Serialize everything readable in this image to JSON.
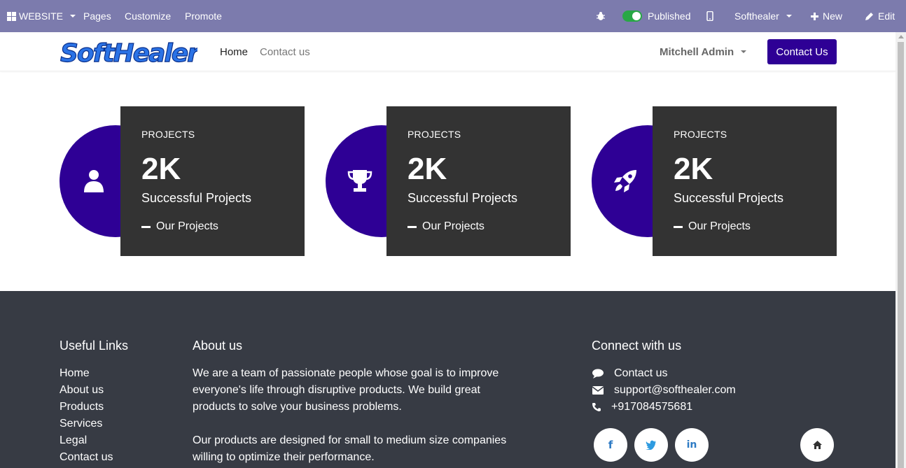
{
  "adminbar": {
    "website_label": "WEBSITE",
    "pages_label": "Pages",
    "customize_label": "Customize",
    "promote_label": "Promote",
    "published_label": "Published",
    "company_label": "Softhealer",
    "new_label": "New",
    "edit_label": "Edit"
  },
  "header": {
    "logo_text": "SoftHealer",
    "nav": [
      {
        "label": "Home"
      },
      {
        "label": "Contact us"
      }
    ],
    "user_label": "Mitchell Admin",
    "cta_label": "Contact Us"
  },
  "stats": [
    {
      "label": "PROJECTS",
      "number": "2K",
      "description": "Successful Projects",
      "link": "Our Projects",
      "icon": "user-icon"
    },
    {
      "label": "PROJECTS",
      "number": "2K",
      "description": "Successful Projects",
      "link": "Our Projects",
      "icon": "trophy-icon"
    },
    {
      "label": "PROJECTS",
      "number": "2K",
      "description": "Successful Projects",
      "link": "Our Projects",
      "icon": "rocket-icon"
    }
  ],
  "footer": {
    "useful_links_heading": "Useful Links",
    "useful_links": [
      "Home",
      "About us",
      "Products",
      "Services",
      "Legal",
      "Contact us"
    ],
    "about_heading": "About us",
    "about_p1": "We are a team of passionate people whose goal is to improve everyone's life through disruptive products. We build great products to solve your business problems.",
    "about_p2": "Our products are designed for small to medium size companies willing to optimize their performance.",
    "connect_heading": "Connect with us",
    "contact_link": "Contact us",
    "email": "support@softhealer.com",
    "phone": "+917084575681",
    "social": [
      {
        "icon": "facebook-icon",
        "glyph": "f"
      },
      {
        "icon": "twitter-icon",
        "glyph": "t"
      },
      {
        "icon": "linkedin-icon",
        "glyph": "in"
      }
    ]
  },
  "colors": {
    "adminbar": "#7c7bad",
    "brand": "#2e0095",
    "card": "#333333",
    "footer": "#373b44"
  }
}
